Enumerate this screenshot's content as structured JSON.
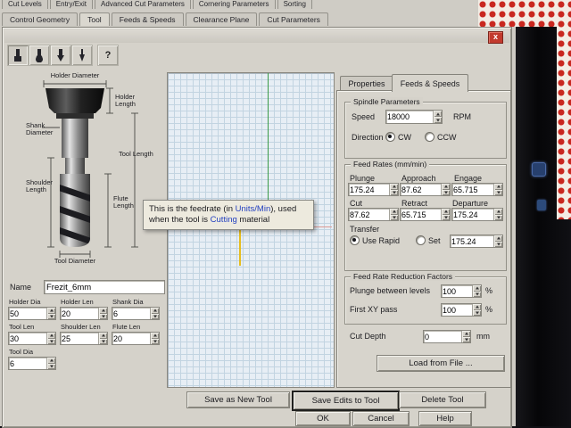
{
  "tabs_row1": [
    "Cut Levels",
    "Entry/Exit",
    "Advanced Cut Parameters",
    "Cornering Parameters",
    "Sorting"
  ],
  "tabs_row2": [
    "Control Geometry",
    "Tool",
    "Feeds & Speeds",
    "Clearance Plane",
    "Cut Parameters"
  ],
  "dialog": {
    "close": "x",
    "toolbar": {
      "help": "?"
    }
  },
  "diagram": {
    "holder_diameter": "Holder Diameter",
    "holder_length": "Holder Length",
    "shank_diameter": "Shank Diameter",
    "tool_length": "Tool Length",
    "shoulder_length": "Shoulder Length",
    "flute_length": "Flute Length",
    "tool_diameter": "Tool Diameter"
  },
  "name_field": {
    "label": "Name",
    "value": "Frezit_6mm"
  },
  "geom_fields": [
    {
      "label": "Holder Dia",
      "value": "50"
    },
    {
      "label": "Holder Len",
      "value": "20"
    },
    {
      "label": "Shank Dia",
      "value": "6"
    },
    {
      "label": "Tool Len",
      "value": "30"
    },
    {
      "label": "Shoulder Len",
      "value": "25"
    },
    {
      "label": "Flute Len",
      "value": "20"
    },
    {
      "label": "Tool Dia",
      "value": "6"
    }
  ],
  "tooltip": {
    "pre": "This is the feedrate (in ",
    "hl1": "Units/Min",
    "mid": "), used when the tool is ",
    "hl2": "Cutting",
    "post": " material"
  },
  "right": {
    "tabs": [
      "Properties",
      "Feeds & Speeds"
    ],
    "spindle": {
      "title": "Spindle Parameters",
      "speed_label": "Speed",
      "speed_value": "18000",
      "rpm": "RPM",
      "direction_label": "Direction",
      "cw": "CW",
      "ccw": "CCW"
    },
    "feed": {
      "title": "Feed Rates (mm/min)",
      "fields": [
        {
          "label": "Plunge",
          "value": "175.24"
        },
        {
          "label": "Approach",
          "value": "87.62"
        },
        {
          "label": "Engage",
          "value": "65.715"
        },
        {
          "label": "Cut",
          "value": "87.62"
        },
        {
          "label": "Retract",
          "value": "65.715"
        },
        {
          "label": "Departure",
          "value": "175.24"
        }
      ],
      "transfer_label": "Transfer",
      "use_rapid": "Use Rapid",
      "set_label": "Set",
      "set_value": "175.24"
    },
    "reduction": {
      "title": "Feed Rate Reduction Factors",
      "rows": [
        {
          "label": "Plunge between levels",
          "value": "100",
          "unit": "%"
        },
        {
          "label": "First XY pass",
          "value": "100",
          "unit": "%"
        }
      ]
    },
    "cut_depth": {
      "label": "Cut Depth",
      "value": "0",
      "unit": "mm"
    },
    "load_button": "Load from File ..."
  },
  "buttons": {
    "save_new": "Save as New Tool",
    "save_edits": "Save Edits to Tool",
    "delete": "Delete Tool",
    "ok": "OK",
    "cancel": "Cancel",
    "help": "Help"
  }
}
